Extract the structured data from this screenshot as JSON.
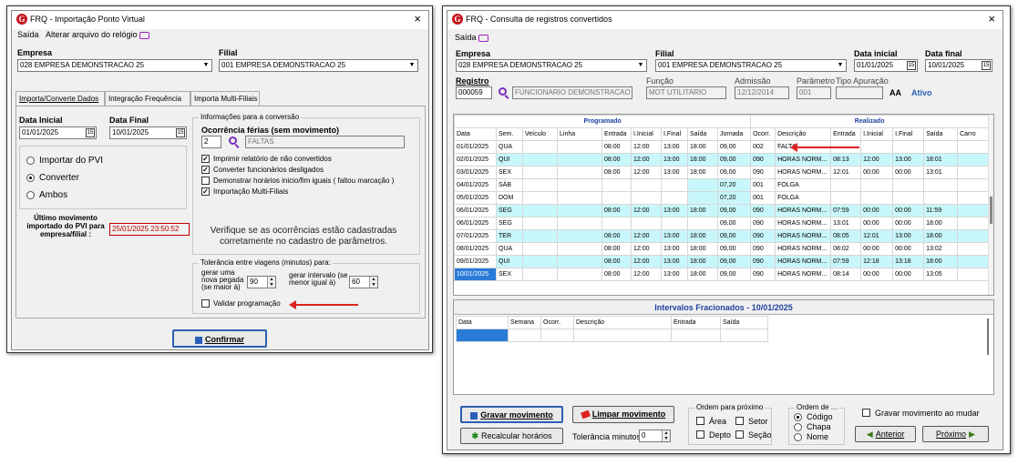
{
  "win1": {
    "title": "FRQ - Importação Ponto Virtual",
    "close": "×",
    "menu": [
      "Saída",
      "Alterar arquivo do relógio"
    ],
    "empresa_label": "Empresa",
    "empresa_value": "028 EMPRESA DEMONSTRACAO 25",
    "filial_label": "Filial",
    "filial_value": "001 EMPRESA DEMONSTRACAO 25",
    "tabs": [
      "Importa/Converte Dados",
      "Integração Frequência",
      "Importa Multi-Filiais"
    ],
    "data_inicial_label": "Data Inicial",
    "data_inicial": "01/01/2025",
    "data_final_label": "Data Final",
    "data_final": "10/01/2025",
    "radios": [
      "Importar do PVI",
      "Converter",
      "Ambos"
    ],
    "ultimo_label": "Último movimento importado do PVI para empresa/filial :",
    "ultimo_value": "25/01/2025  23:50:52",
    "info_group": "Informações para a conversão",
    "ocorrencia_label": "Ocorrência férias (sem movimento)",
    "ocorrencia_code": "2",
    "ocorrencia_desc": "FALTAS",
    "checks": [
      {
        "label": "Imprimir relatório de não convertidos",
        "checked": true
      },
      {
        "label": "Converter funcionários desligados",
        "checked": true
      },
      {
        "label": "Demonstrar horários inicio/fim iguais ( faltou marcação )",
        "checked": false
      },
      {
        "label": "Importação Multi-Filiais",
        "checked": true
      }
    ],
    "verifique": "Verifique se as ocorrências estão cadastradas corretamente  no cadastro de parâmetros.",
    "tol_group": "Tolerância entre viagens (minutos) para:",
    "gerar_uma": "gerar uma nova pegada (se maior à)",
    "gerar_uma_value": "90",
    "gerar_intervalo": "gerar intervalo (se menor igual à)",
    "gerar_intervalo_value": "60",
    "validar": "Validar programação",
    "confirmar": "Confirmar"
  },
  "win2": {
    "title": "FRQ - Consulta de registros convertidos",
    "close": "×",
    "menu": [
      "Saída"
    ],
    "empresa_label": "Empresa",
    "empresa_value": "028 EMPRESA DEMONSTRACAO 25",
    "filial_label": "Filial",
    "filial_value": "001 EMPRESA DEMONSTRACAO 25",
    "data_inicial_label": "Data inicial",
    "data_inicial": "01/01/2025",
    "data_final_label": "Data final",
    "data_final": "10/01/2025",
    "registro_label": "Registro",
    "registro_value": "000059",
    "funcionario": "FUNCIONARIO DEMONSTRACAO",
    "funcao_label": "Função",
    "funcao_value": "MOT UTILITARIO",
    "admissao_label": "Admissão",
    "admissao_value": "12/12/2014",
    "parametro_label": "Parâmetro",
    "parametro_value": "001",
    "tipo_label": "Tipo Apuração",
    "tipo_value": "",
    "ativo": "Ativo",
    "aa": "AA",
    "programado": "Programado",
    "realizado": "Realizado",
    "columns": [
      "Data",
      "Sem.",
      "Veículo",
      "Linha",
      "Entrada",
      "I.Inicial",
      "I.Final",
      "Saída",
      "Jornada",
      "Ocorr.",
      "Descrição",
      "Entrada",
      "I.Inicial",
      "I.Final",
      "Saída",
      "Carro"
    ],
    "rows": [
      [
        "01/01/2025",
        "QUA",
        "",
        "",
        "08:00",
        "12:00",
        "13:00",
        "18:00",
        "09,00",
        "002",
        "FALTA",
        "",
        "",
        "",
        "",
        ""
      ],
      [
        "02/01/2025",
        "QUI",
        "",
        "",
        "08:00",
        "12:00",
        "13:00",
        "18:00",
        "09,00",
        "090",
        "HORAS NORM...",
        "08:13",
        "12:00",
        "13:00",
        "18:01",
        ""
      ],
      [
        "03/01/2025",
        "SEX",
        "",
        "",
        "08:00",
        "12:00",
        "13:00",
        "18:00",
        "09,00",
        "090",
        "HORAS NORM...",
        "12:01",
        "00:00",
        "00:00",
        "13:01",
        ""
      ],
      [
        "04/01/2025",
        "SÁB",
        "",
        "",
        "",
        "",
        "",
        "",
        "07,20",
        "001",
        "FOLGA",
        "",
        "",
        "",
        "",
        ""
      ],
      [
        "05/01/2025",
        "DOM",
        "",
        "",
        "",
        "",
        "",
        "",
        "07,20",
        "001",
        "FOLGA",
        "",
        "",
        "",
        "",
        ""
      ],
      [
        "06/01/2025",
        "SEG",
        "",
        "",
        "08:00",
        "12:00",
        "13:00",
        "18:00",
        "09,00",
        "090",
        "HORAS NORM...",
        "07:59",
        "00:00",
        "00:00",
        "11:59",
        ""
      ],
      [
        "06/01/2025",
        "SEG",
        "",
        "",
        "",
        "",
        "",
        "",
        "09,00",
        "090",
        "HORAS NORM...",
        "13:01",
        "00:00",
        "00:00",
        "18:00",
        ""
      ],
      [
        "07/01/2025",
        "TER",
        "",
        "",
        "08:00",
        "12:00",
        "13:00",
        "18:00",
        "09,00",
        "090",
        "HORAS NORM...",
        "08:05",
        "12:01",
        "13:00",
        "18:00",
        ""
      ],
      [
        "08/01/2025",
        "QUA",
        "",
        "",
        "08:00",
        "12:00",
        "13:00",
        "18:00",
        "09,00",
        "090",
        "HORAS NORM...",
        "08:02",
        "00:00",
        "00:00",
        "13:02",
        ""
      ],
      [
        "09/01/2025",
        "QUI",
        "",
        "",
        "08:00",
        "12:00",
        "13:00",
        "18:00",
        "09,00",
        "090",
        "HORAS NORM...",
        "07:59",
        "12:18",
        "13:18",
        "18:00",
        ""
      ],
      [
        "10/01/2025",
        "SEX",
        "",
        "",
        "08:00",
        "12:00",
        "13:00",
        "18:00",
        "09,00",
        "090",
        "HORAS NORM...",
        "08:14",
        "00:00",
        "00:00",
        "13:05",
        ""
      ]
    ],
    "intervalos_title": "Intervalos Fracionados - 10/01/2025",
    "int_columns": [
      "Data",
      "Semana",
      "Ocorr.",
      "Descrição",
      "Entrada",
      "Saída"
    ],
    "gravar": "Gravar movimento",
    "limpar": "Limpar movimento",
    "recalcular": "Recalcular horários",
    "tolerancia_label": "Tolerância minutos",
    "tolerancia_value": "0",
    "ordem_prox": "Ordem para próximo",
    "ordem_prox_items": [
      "Área",
      "Setor",
      "Depto",
      "Seção"
    ],
    "ordem_de": "Ordem de ...",
    "ordem_de_items": [
      "Código",
      "Chapa",
      "Nome"
    ],
    "gravar_mudar": "Gravar movimento ao mudar",
    "anterior": "Anterior",
    "proximo": "Próximo"
  }
}
